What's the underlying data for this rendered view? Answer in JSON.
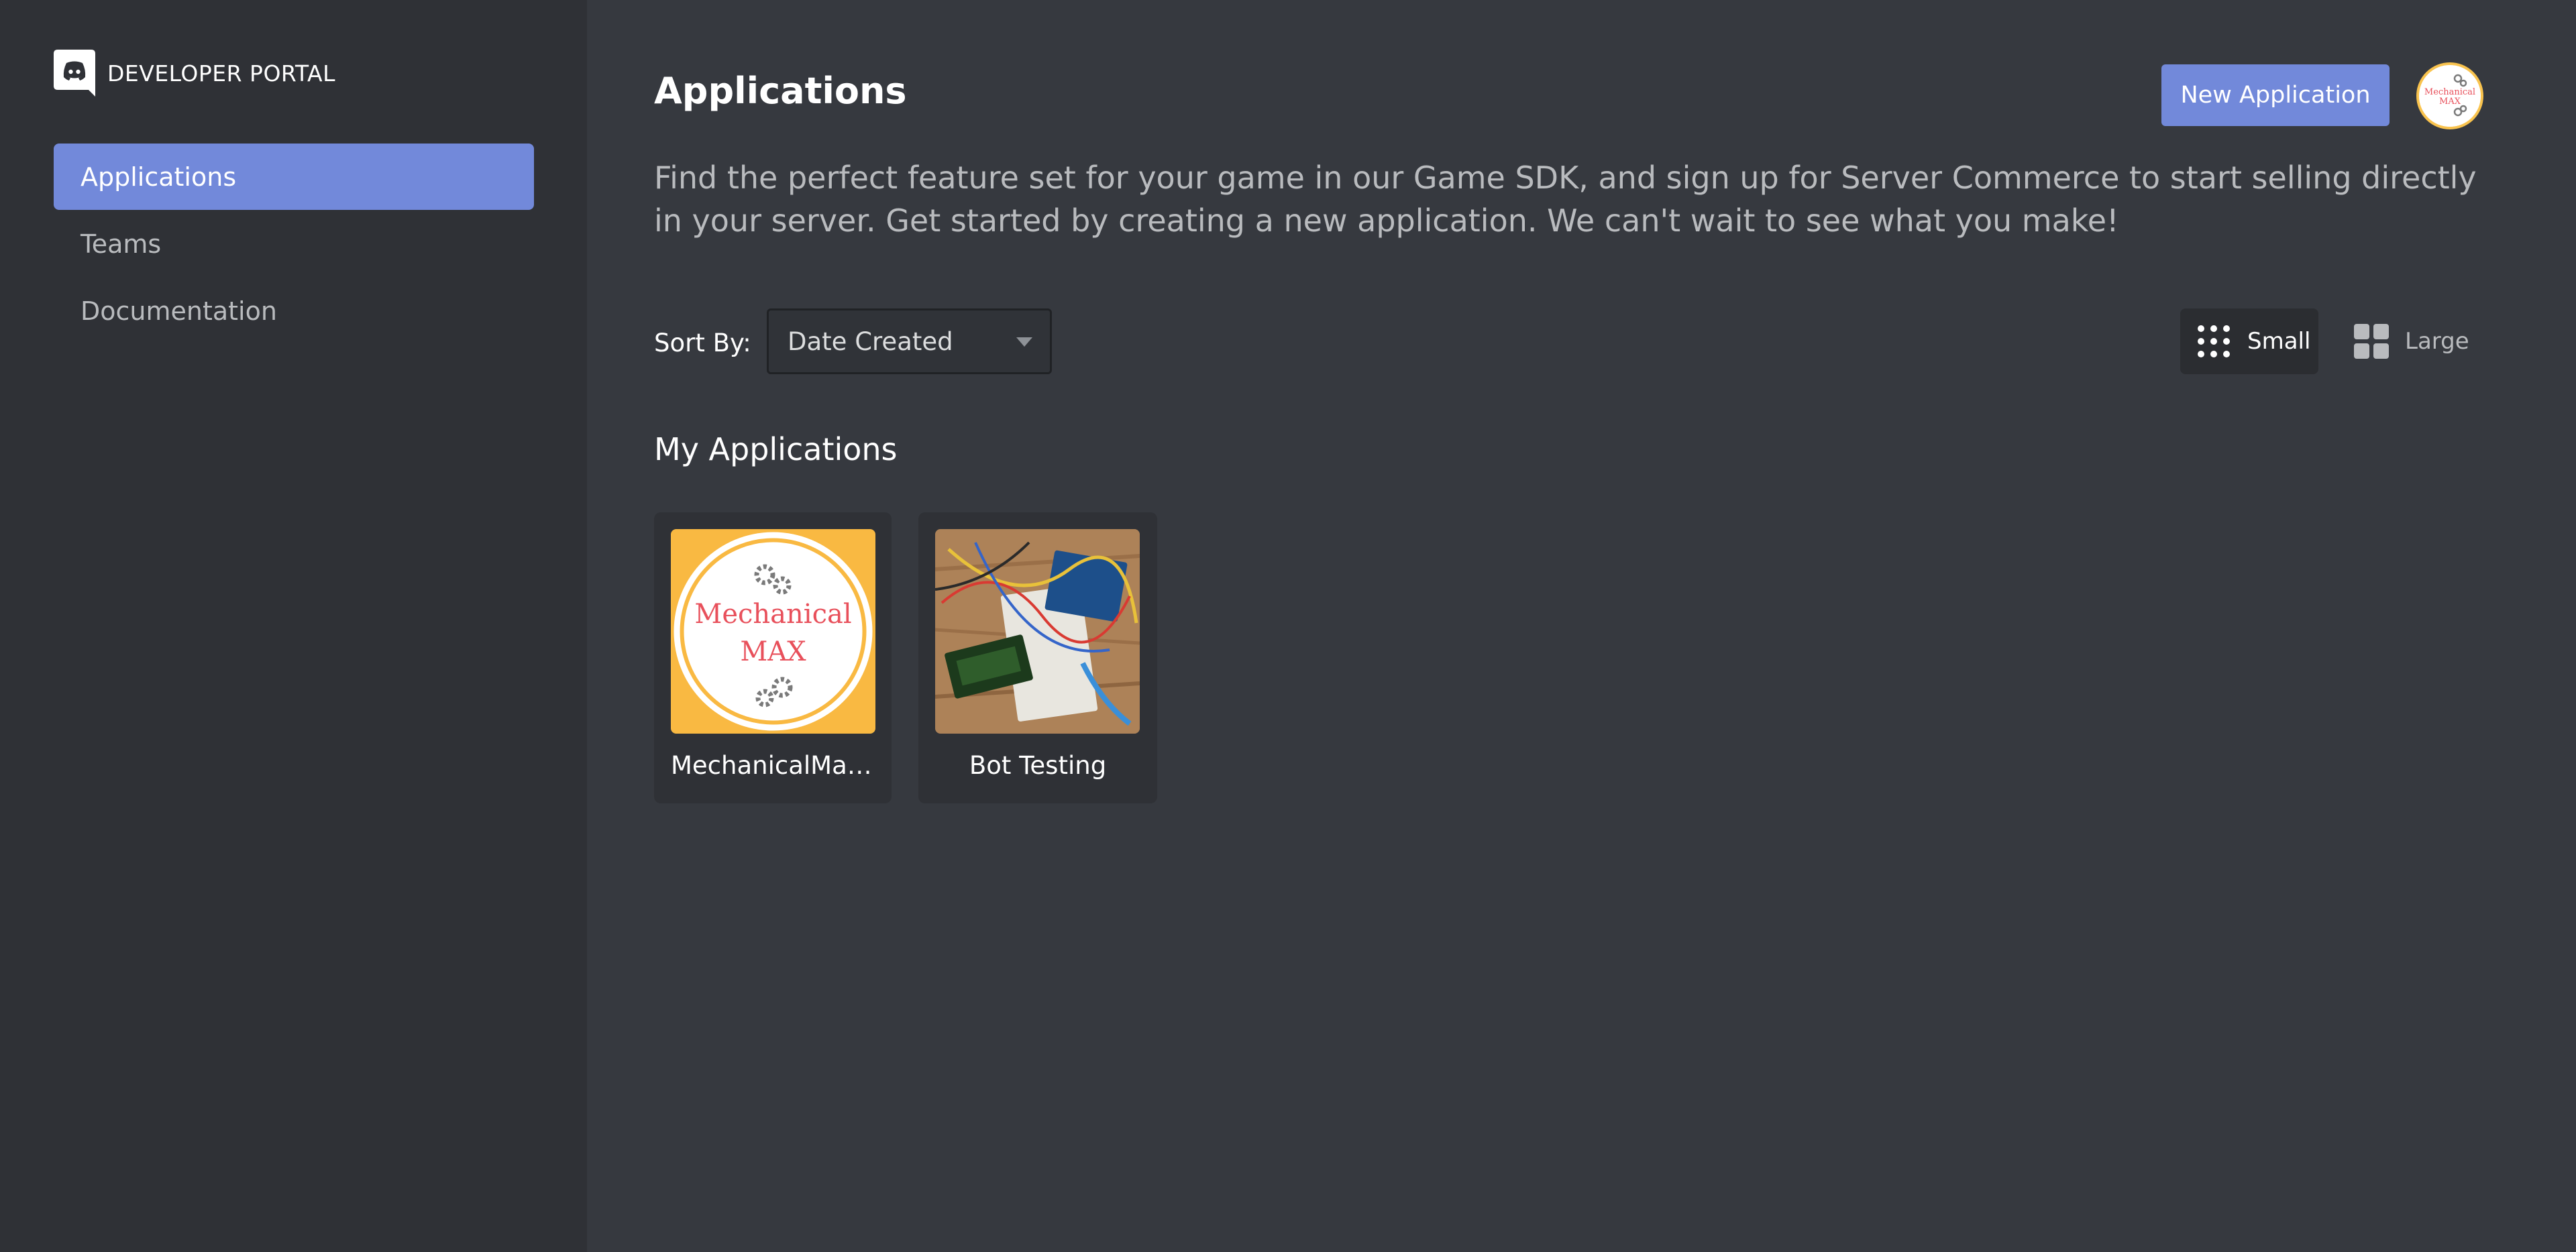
{
  "sidebar": {
    "brand": "DEVELOPER PORTAL",
    "items": [
      {
        "label": "Applications",
        "active": true
      },
      {
        "label": "Teams",
        "active": false
      },
      {
        "label": "Documentation",
        "active": false
      }
    ]
  },
  "header": {
    "title": "Applications",
    "new_app_label": "New Application",
    "description": "Find the perfect feature set for your game in our Game SDK, and sign up for Server Commerce to start selling directly in your server. Get started by creating a new application. We can't wait to see what you make!"
  },
  "sort": {
    "label": "Sort By:",
    "selected": "Date Created"
  },
  "view_toggle": {
    "small_label": "Small",
    "large_label": "Large",
    "selected": "Small"
  },
  "apps_section": {
    "title": "My Applications",
    "apps": [
      {
        "name": "MechanicalMax...",
        "icon_text_line1": "Mechanical",
        "icon_text_line2": "MAX"
      },
      {
        "name": "Bot Testing"
      }
    ]
  },
  "avatar": {
    "text_line1": "Mechanical",
    "text_line2": "MAX"
  },
  "colors": {
    "accent": "#7289da",
    "sidebar_bg": "#2f3136",
    "main_bg": "#36393f",
    "mech_max_bg": "#f9b942",
    "mech_max_text": "#e8505b"
  },
  "icons": [
    "discord-logo-icon",
    "grid-small-icon",
    "grid-large-icon",
    "chevron-down-icon",
    "gear-icon"
  ]
}
